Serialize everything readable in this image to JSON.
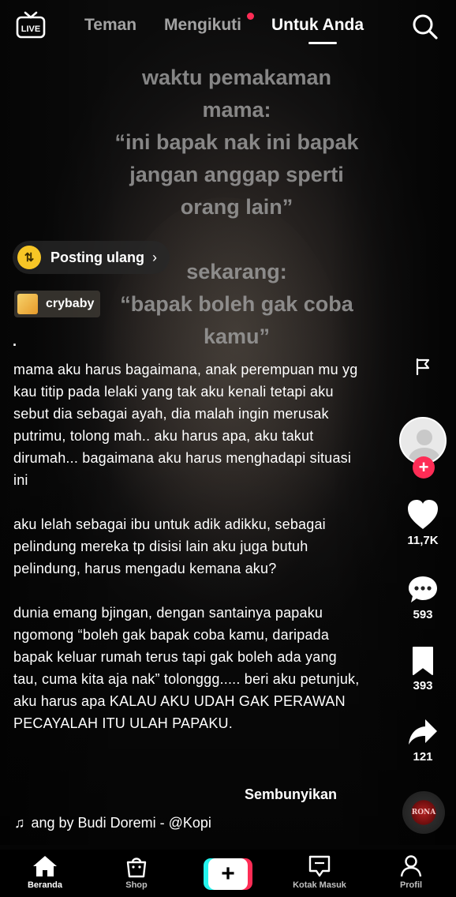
{
  "top_nav": {
    "live_label": "LIVE",
    "tabs": [
      {
        "label": "Teman"
      },
      {
        "label": "Mengikuti"
      },
      {
        "label": "Untuk Anda"
      }
    ]
  },
  "overlay": {
    "top_lines": [
      "waktu pemakaman",
      "mama:",
      "“ini bapak nak ini bapak",
      "jangan anggap sperti",
      "orang lain”"
    ],
    "bottom_lines": [
      "sekarang:",
      "“bapak boleh gak coba",
      "kamu”"
    ]
  },
  "repost": {
    "label": "Posting ulang",
    "chevron": "›"
  },
  "tag": {
    "label": "crybaby"
  },
  "description": {
    "dot": ".",
    "paragraphs": [
      "mama aku harus bagaimana, anak perempuan mu yg kau titip pada lelaki yang tak aku kenali tetapi aku sebut dia sebagai ayah, dia malah ingin merusak putrimu, tolong mah.. aku harus apa, aku takut dirumah... bagaimana aku harus menghadapi situasi ini",
      "aku lelah sebagai ibu untuk adik adikku, sebagai pelindung mereka tp disisi lain aku juga butuh pelindung, harus mengadu kemana aku?",
      "dunia emang bjingan, dengan santainya papaku ngomong “boleh gak bapak coba kamu, daripada bapak keluar rumah terus tapi gak boleh ada yang tau, cuma kita aja nak” tolonggg..... beri aku petunjuk, aku harus apa KALAU AKU UDAH GAK PERAWAN PECAYALAH ITU ULAH PAPAKU."
    ],
    "hide_label": "Sembunyikan"
  },
  "music": {
    "note": "♫",
    "text": "ang by Budi Doremi - @Kopi"
  },
  "actions": {
    "likes": "11,7K",
    "comments": "593",
    "bookmarks": "393",
    "shares": "121",
    "follow_symbol": "+",
    "disc_label": "RONA"
  },
  "bottom_nav": {
    "items": [
      {
        "label": "Beranda"
      },
      {
        "label": "Shop"
      },
      {
        "label": "Kotak Masuk"
      },
      {
        "label": "Profil"
      }
    ],
    "create_symbol": "+"
  },
  "colors": {
    "accent": "#fe2c55",
    "repost_badge": "#f7c626",
    "cyan": "#25f4ee"
  }
}
